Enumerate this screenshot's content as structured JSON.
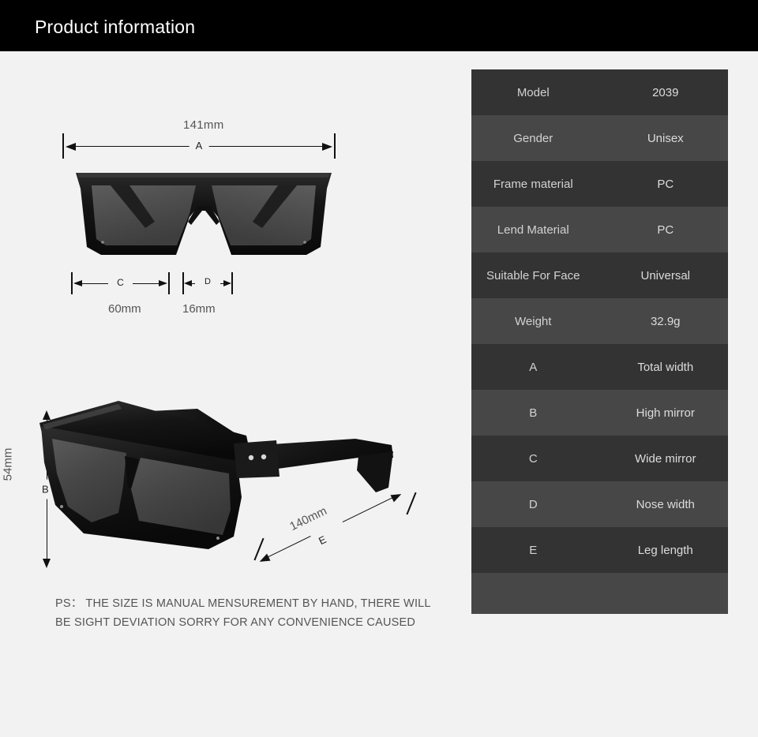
{
  "header": {
    "title": "Product information"
  },
  "front_view": {
    "total_width_label": "141mm",
    "dimension_a_letter": "A",
    "width_c_label": "60mm",
    "dimension_c_letter": "C",
    "width_d_label": "16mm",
    "dimension_d_letter": "D",
    "image_alt": "sunglasses-front-view"
  },
  "angled_view": {
    "height_b_label": "54mm",
    "dimension_b_letter": "B",
    "leg_e_label": "140mm",
    "dimension_e_letter": "E",
    "image_alt": "sunglasses-angled-view"
  },
  "ps_note": {
    "line1": "PS： THE SIZE IS MANUAL MENSUREMENT BY HAND, THERE WILL",
    "line2": "BE SIGHT DEVIATION SORRY FOR ANY CONVENIENCE CAUSED"
  },
  "spec_table": {
    "rows": [
      {
        "key": "Model",
        "value": "2039"
      },
      {
        "key": "Gender",
        "value": "Unisex"
      },
      {
        "key": "Frame material",
        "value": "PC"
      },
      {
        "key": "Lend Material",
        "value": "PC"
      },
      {
        "key": "Suitable For Face",
        "value": "Universal"
      },
      {
        "key": "Weight",
        "value": "32.9g"
      },
      {
        "key": "A",
        "value": "Total width"
      },
      {
        "key": "B",
        "value": "High mirror"
      },
      {
        "key": "C",
        "value": "Wide mirror"
      },
      {
        "key": "D",
        "value": "Nose width"
      },
      {
        "key": "E",
        "value": "Leg length"
      },
      {
        "key": "",
        "value": ""
      }
    ]
  },
  "colors": {
    "page_background": "#f2f2f2",
    "header_background": "#000000",
    "header_text": "#ffffff",
    "row_dark": "#333333",
    "row_light": "#474747",
    "row_text": "#d6d6d6",
    "dimension_line": "#111111",
    "dimension_label": "#555555",
    "frame_black": "#111111",
    "lens_gray": "#4a4a4a"
  }
}
